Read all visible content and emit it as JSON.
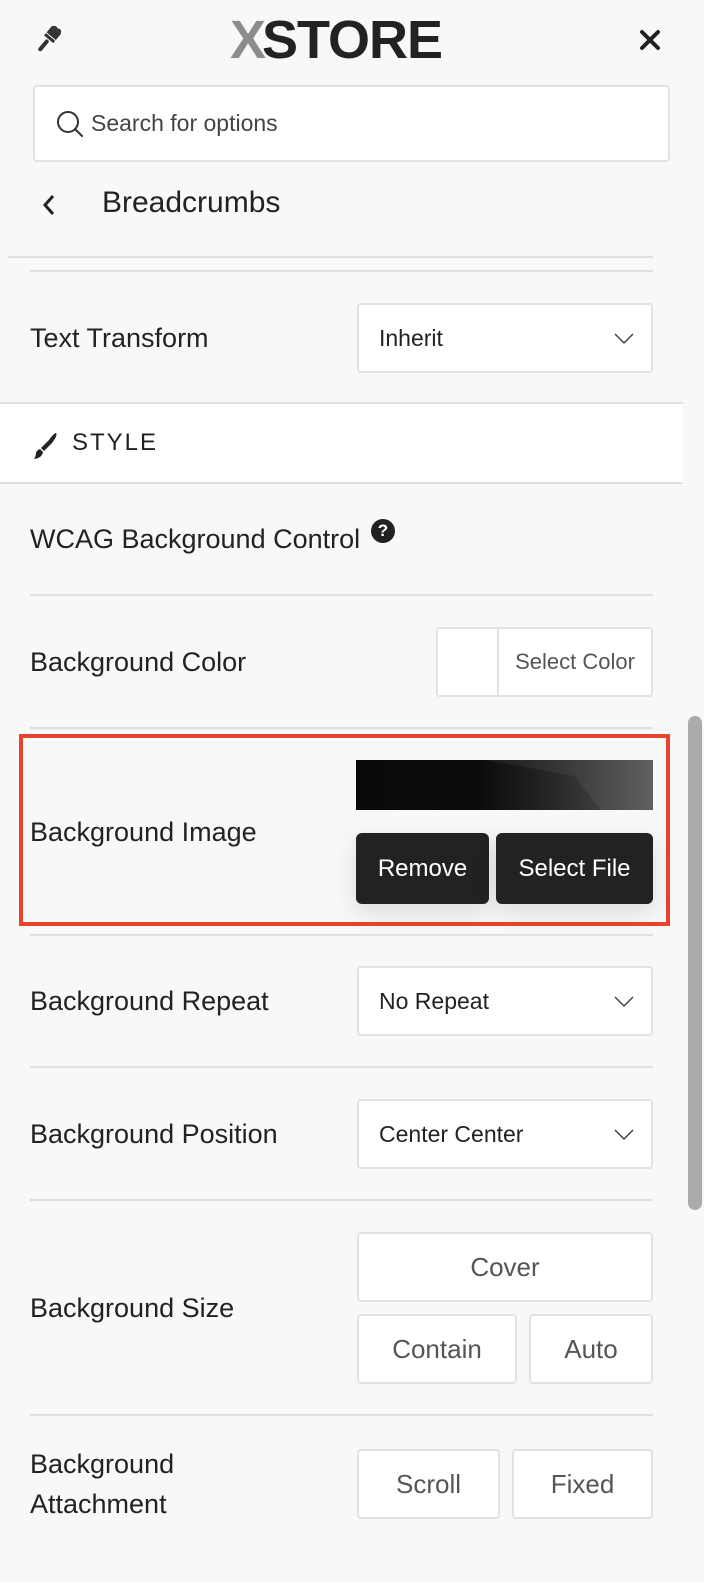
{
  "header": {
    "logo_prefix": "X",
    "logo_text": "STORE",
    "icons": {
      "left": "paint-brush-icon",
      "right": "close-icon"
    }
  },
  "search": {
    "placeholder": "Search for options",
    "value": ""
  },
  "breadcrumb": {
    "title": "Breadcrumbs",
    "back_icon": "chevron-left-icon"
  },
  "text_transform": {
    "label": "Text Transform",
    "value": "Inherit"
  },
  "style_section": {
    "title": "STYLE",
    "icon": "paint-brush-icon"
  },
  "wcag": {
    "label": "WCAG Background Control",
    "help": "?"
  },
  "background_color": {
    "label": "Background Color",
    "button_label": "Select Color",
    "swatch_color": "#ffffff"
  },
  "background_image": {
    "label": "Background Image",
    "remove_label": "Remove",
    "select_label": "Select File",
    "highlight_color": "#e8442b"
  },
  "background_repeat": {
    "label": "Background Repeat",
    "value": "No Repeat"
  },
  "background_position": {
    "label": "Background Position",
    "value": "Center Center"
  },
  "background_size": {
    "label": "Background Size",
    "options": [
      "Cover",
      "Contain",
      "Auto"
    ]
  },
  "background_attachment": {
    "label_line1": "Background",
    "label_line2": "Attachment",
    "options": [
      "Scroll",
      "Fixed"
    ]
  }
}
